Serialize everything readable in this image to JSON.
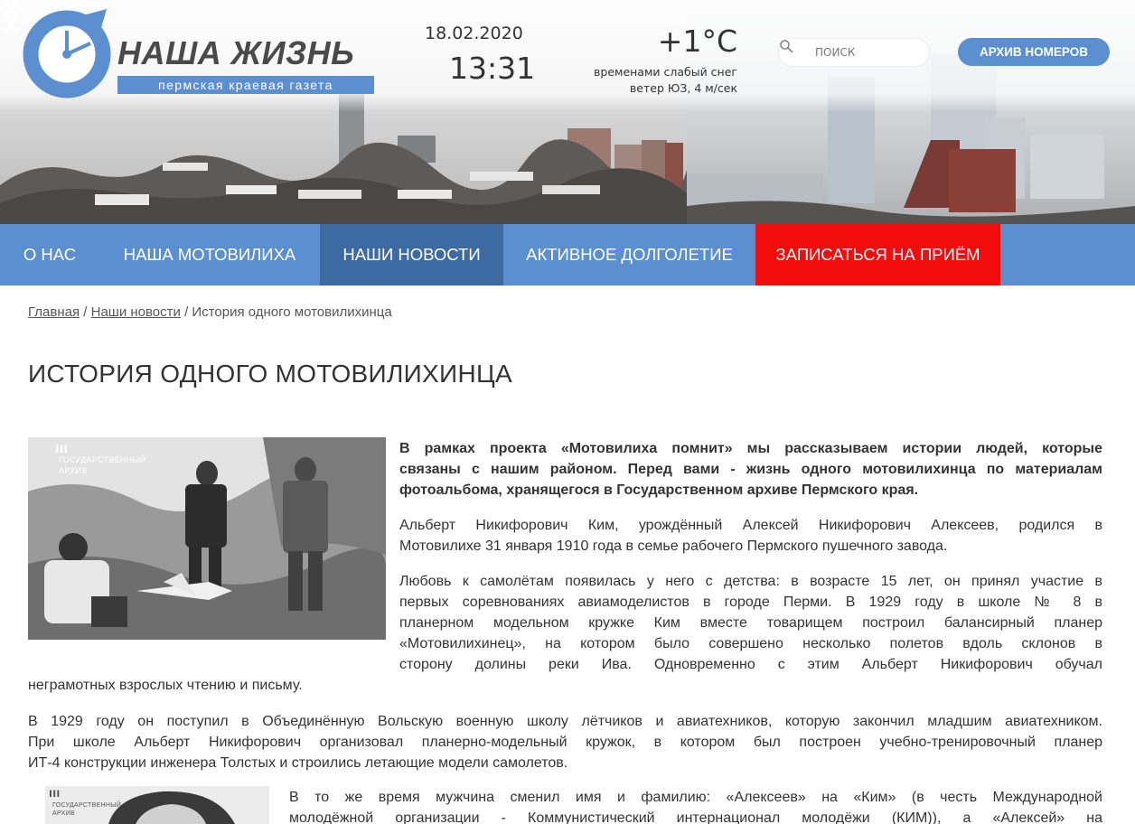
{
  "header": {
    "logo_title": "НАША ЖИЗНЬ",
    "logo_subtitle": "пермская краевая газета",
    "date": "18.02.2020",
    "time": "13:31",
    "temperature": "+1°C",
    "weather_line1": "временами слабый снег",
    "weather_line2": "ветер ЮЗ, 4 м/сек",
    "search_placeholder": "ПОИСК",
    "archive_button": "АРХИВ НОМЕРОВ",
    "icons": {
      "logo": "clock-arrow-logo-icon",
      "search": "search-icon",
      "prev": "chevron-left-icon",
      "next": "chevron-right-icon"
    }
  },
  "nav": {
    "items": [
      {
        "label": "О НАС",
        "active": false
      },
      {
        "label": "НАША МОТОВИЛИХА",
        "active": false
      },
      {
        "label": "НАШИ НОВОСТИ",
        "active": true
      },
      {
        "label": "АКТИВНОЕ ДОЛГОЛЕТИЕ",
        "active": false
      },
      {
        "label": "ЗАПИСАТЬСЯ НА ПРИЁМ",
        "active": false,
        "highlight": "#f20c0c"
      }
    ]
  },
  "breadcrumb": {
    "home": "Главная",
    "section": "Наши новости",
    "current": "История одного мотовилихинца",
    "separator": "/"
  },
  "article": {
    "title": "ИСТОРИЯ ОДНОГО МОТОВИЛИХИНЦА",
    "photo_watermark_line1": "ГОСУДАРСТВЕННЫЙ",
    "photo_watermark_line2": "АРХИВ",
    "intro_lines": [
      "В рамках проекта «Мотовилиха помнит» мы рассказываем истории людей, которые",
      "связаны с нашим районом. Перед вами - жизнь одного мотовилихинца по материалам",
      "фотоальбома, хранящегося в Государственном архиве Пермского края."
    ],
    "p1_lines": [
      "Альберт Никифорович Ким, урождённый Алексей Никифорович Алексеев, родился в",
      "Мотовилихе 31 января 1910 года в семье рабочего Пермского пушечного завода."
    ],
    "p2_lines": [
      "Любовь к самолётам появилась у него с детства: в возрасте 15 лет, он принял участие в",
      "первых соревнованиях авиамоделистов в городе Перми. В 1929 году в школе № 8 в",
      "планерном модельном кружке Ким вместе товарищем построил балансирный планер",
      "«Мотовилихинец», на котором было совершено несколько полетов вдоль склонов в",
      "сторону долины реки Ива. Одновременно с этим Альберт Никифорович обучал",
      "неграмотных взрослых чтению и письму."
    ],
    "p3_lines": [
      "В 1929 году он поступил в Объединённую Вольскую военную школу лётчиков и авиатехников, которую закончил младшим авиатехником.",
      "При школе Альберт Никифорович организовал планерно-модельный кружок, в котором был построен учебно-тренировочный планер",
      "ИТ-4 конструкции инженера Толстых и строились летающие модели самолетов."
    ],
    "p4_lines": [
      "В то же время мужчина сменил имя и фамилию: «Алексеев» на «Ким» (в честь Международной",
      "молодёжной организации - Коммунистический интернационал молодёжи (КИМ)), а «Алексей» на"
    ]
  },
  "colors": {
    "brand_blue": "#5b8fd0",
    "nav_active": "#3d6aa0",
    "nav_highlight": "#f20c0c",
    "text": "#333333"
  }
}
